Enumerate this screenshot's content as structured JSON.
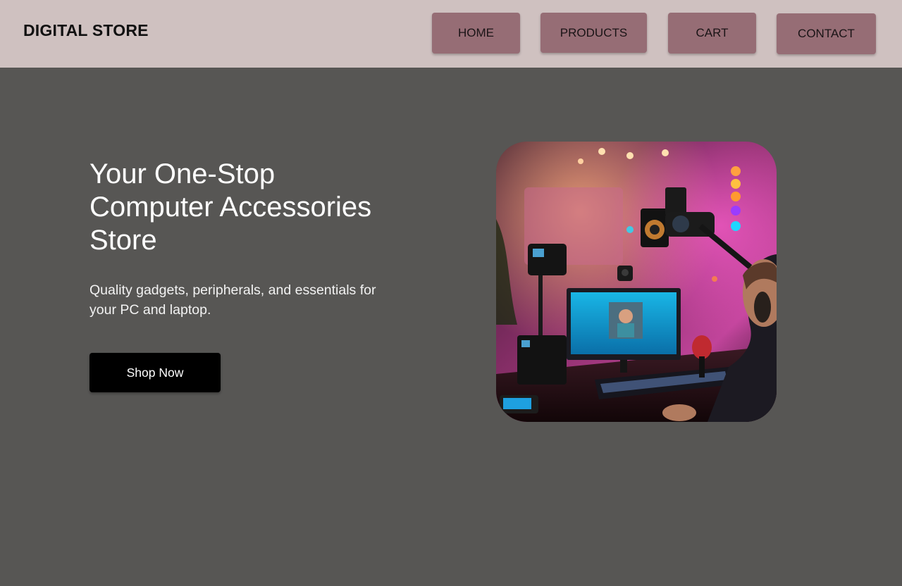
{
  "header": {
    "brand": "DIGITAL STORE",
    "nav": [
      {
        "label": "HOME"
      },
      {
        "label": "PRODUCTS"
      },
      {
        "label": "CART"
      },
      {
        "label": "CONTACT"
      }
    ]
  },
  "hero": {
    "title": "Your One-Stop Computer Accessories Store",
    "subtitle": "Quality gadgets, peripherals, and essentials for your PC and laptop.",
    "cta_label": "Shop Now",
    "image_name": "streaming-setup-photo"
  },
  "colors": {
    "header_bg": "#cfc1c0",
    "nav_button": "#966d75",
    "page_bg": "#575654",
    "cta_bg": "#000000"
  }
}
